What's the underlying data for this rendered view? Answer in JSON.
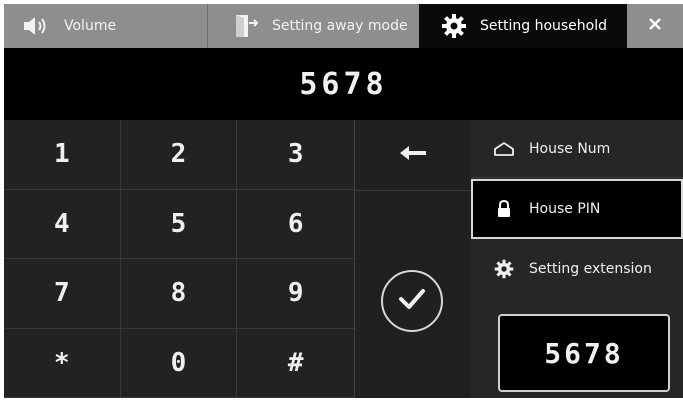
{
  "tabs": {
    "volume": {
      "label": "Volume",
      "icon": "speaker-icon"
    },
    "away": {
      "label": "Setting away mode",
      "icon": "exit-door-icon"
    },
    "household": {
      "label": "Setting household",
      "icon": "gear-icon",
      "active": true
    },
    "close": {
      "icon": "close-icon"
    }
  },
  "display": {
    "value": "5678"
  },
  "keypad": {
    "keys": [
      "1",
      "2",
      "3",
      "4",
      "5",
      "6",
      "7",
      "8",
      "9",
      "*",
      "0",
      "#"
    ]
  },
  "actions": {
    "backspace_icon": "back-arrow-icon",
    "confirm_icon": "checkmark-icon"
  },
  "side_menu": {
    "items": [
      {
        "label": "House Num",
        "icon": "house-icon"
      },
      {
        "label": "House PIN",
        "icon": "lock-icon",
        "selected": true
      },
      {
        "label": "Setting extension",
        "icon": "gear-icon"
      }
    ],
    "value": "5678"
  },
  "colors": {
    "tab_inactive": "#8e8e8e",
    "tab_active": "#0a0a0a",
    "background": "#1a1a1a",
    "text": "#f0f0f0"
  }
}
